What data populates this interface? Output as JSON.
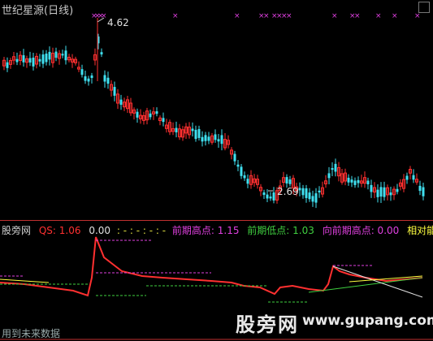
{
  "window": {
    "title": "世纪星源(日线)"
  },
  "price_chart": {
    "max_label": "4.62",
    "min_label": "2.69",
    "colors": {
      "up": "#ff3030",
      "down": "#40e0f0",
      "signal": "#e040e0",
      "background": "#000000"
    }
  },
  "indicator": {
    "name": "股旁网",
    "qs_label": "QS: 1.06",
    "zero_label": "0.00",
    "dash_text": ": -  : -  : -  : -",
    "prev_high_label": "前期高点: 1.15",
    "prev_low_label": "前期低点: 1.03",
    "fwd_high_label": "向前期高点: 0.00",
    "energy_label": "相对能量:",
    "colors": {
      "qs": "#ff3030",
      "high": "#e040e0",
      "low": "#40d040",
      "energy": "#ffff40"
    }
  },
  "watermark": {
    "cn": "股旁网",
    "url": "www.gupang.com"
  },
  "footer": {
    "text": "用到未来数据"
  }
}
